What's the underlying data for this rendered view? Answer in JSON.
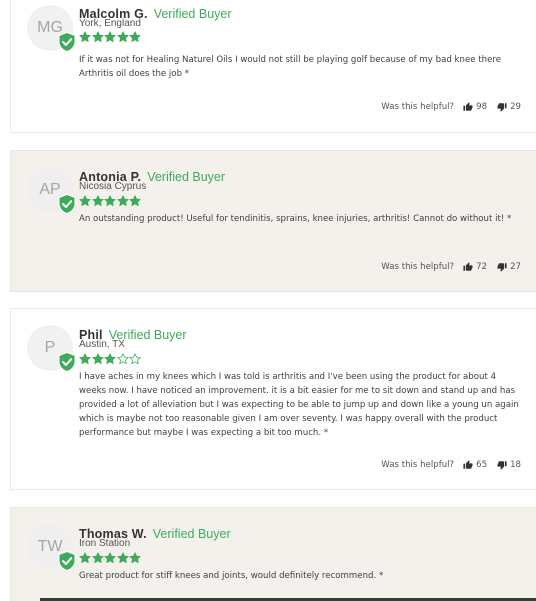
{
  "colors": {
    "verified_green": "#3eaa5b",
    "star_green": "#3eaa5b",
    "alt_background": "#f4f1ec"
  },
  "reviews": [
    {
      "initials": "MG",
      "name": "Malcolm G.",
      "verified_label": "Verified Buyer",
      "location": "York, England",
      "rating": 5,
      "text": "If it was not for Healing Naturel Oils I would not still be playing golf because of my bad knee there Arthritis oil does the job *",
      "helpful_label": "Was this helpful?",
      "upvotes": "98",
      "downvotes": "29"
    },
    {
      "initials": "AP",
      "name": "Antonia P.",
      "verified_label": "Verified Buyer",
      "location": "Nicosia Cyprus",
      "rating": 5,
      "text": "An outstanding product! Useful for tendinitis, sprains, knee injuries, arthritis! Cannot do without it! *",
      "helpful_label": "Was this helpful?",
      "upvotes": "72",
      "downvotes": "27"
    },
    {
      "initials": "P",
      "name": "Phil",
      "verified_label": "Verified Buyer",
      "location": "Austin, TX",
      "rating": 3,
      "text": "I have aches in my knees which I was told is arthritis and I've been using the product for about 4 weeks now. I have noticed an improvement. it is a bit easier for me to sit down and stand up and has provided a lot of alleviation but I was expecting to be able to jump up and down like a young un again which is maybe not too reasonable given I am over seventy. I was happy overall with the product performance but maybe I was expecting a bit too much. *",
      "helpful_label": "Was this helpful?",
      "upvotes": "65",
      "downvotes": "18"
    },
    {
      "initials": "TW",
      "name": "Thomas W.",
      "verified_label": "Verified Buyer",
      "location": "Iron Station",
      "rating": 5,
      "text": "Great product for stiff knees and joints, would definitely recommend. *"
    }
  ]
}
